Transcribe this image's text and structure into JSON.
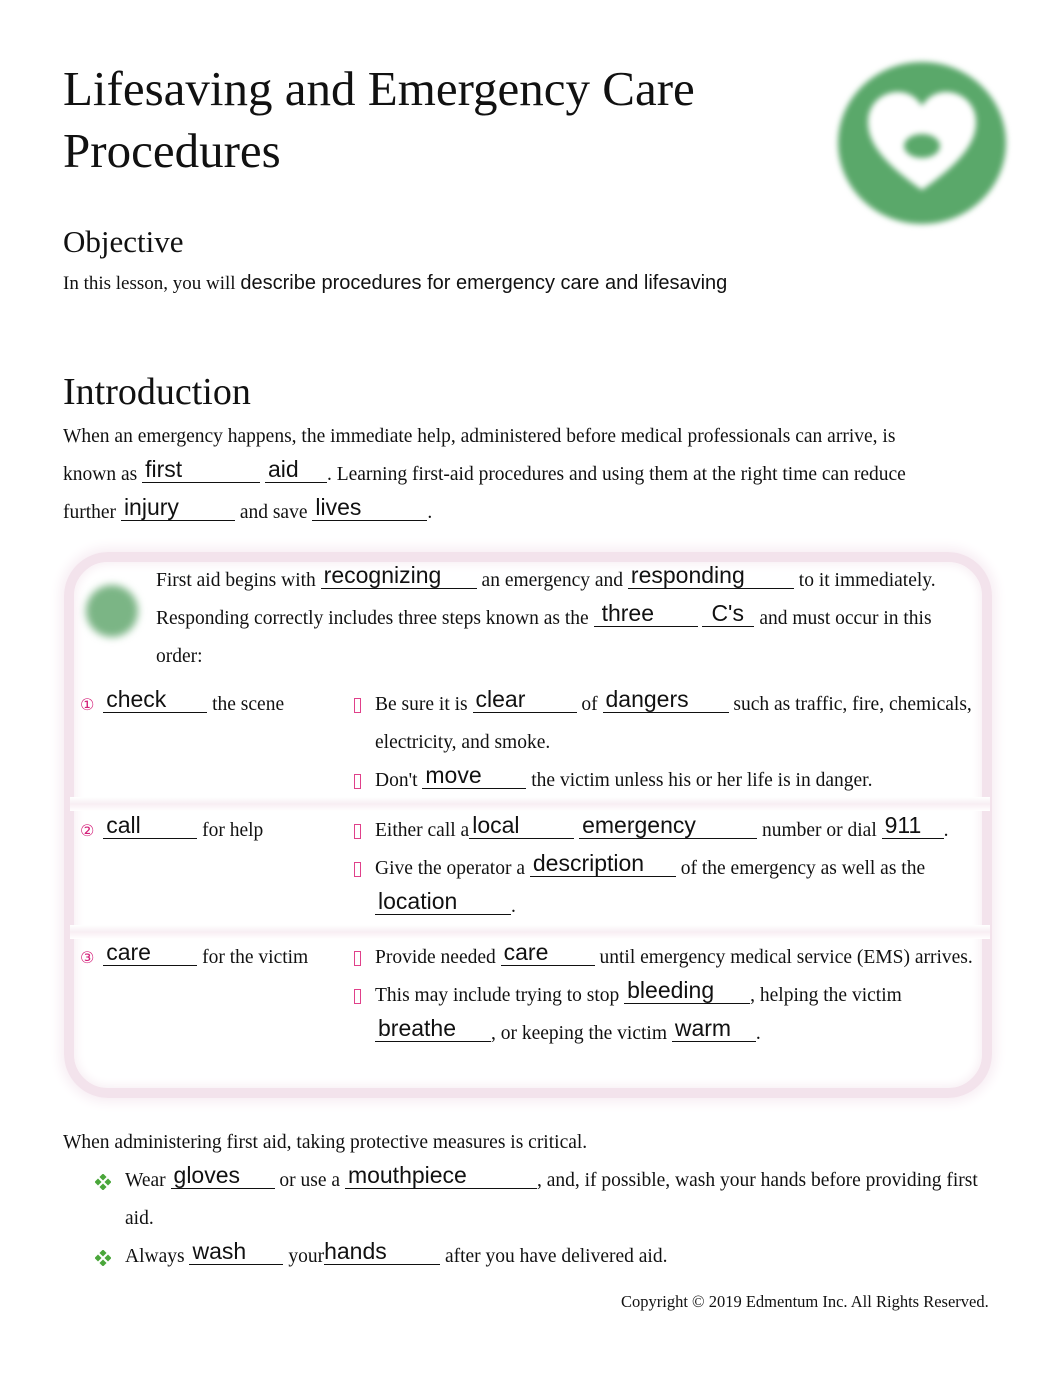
{
  "header": {
    "title": "Lifesaving and Emergency Care Procedures",
    "logo_icon": "heart-icon",
    "logo_color": "#5aa86a"
  },
  "objective": {
    "heading": "Objective",
    "lead": "In this lesson, you will",
    "text": "describe procedures for emergency care and lifesaving"
  },
  "introduction": {
    "heading": "Introduction",
    "p1": "When an emergency happens, the immediate help, administered before medical professionals can arrive, is",
    "p2_a": "known as",
    "blank_first": "first",
    "blank_aid": "aid",
    "p2_b": ". Learning first-aid procedures and using them at the right time can reduce",
    "p3_a": "further",
    "blank_injury": "injury",
    "p3_b": "and save",
    "blank_lives": "lives",
    "p3_c": "."
  },
  "callout": {
    "border_color": "#f3e3ec",
    "icon": "tip-icon",
    "t1": "First aid begins with",
    "blank_recognizing": "recognizing",
    "t2": "an emergency and",
    "blank_responding": "responding",
    "t3": "to it immediately.",
    "t4": "Responding correctly includes three steps known as the",
    "blank_three": "three",
    "blank_cs": "C's",
    "t5": "and must occur in this",
    "t6": "order:",
    "accent_color": "#d4207a",
    "steps": [
      {
        "number": "①",
        "answer": "check",
        "label": "the scene",
        "bullets": [
          {
            "a": "Be sure it is",
            "b1": "clear",
            "m": "of",
            "b2": "dangers",
            "z": "such as traffic, fire, chemicals, electricity, and smoke."
          },
          {
            "a": "Don't",
            "b1": "move",
            "z": "the victim unless his or her life is in danger."
          }
        ]
      },
      {
        "number": "②",
        "answer": "call",
        "label": "for help",
        "bullets": [
          {
            "a": "Either call a",
            "b1": "local",
            "b2": "emergency",
            "m": "number or dial",
            "b3": "911",
            "z": "."
          },
          {
            "a": "Give the operator a",
            "b1": "description",
            "m": "of the emergency as well as the",
            "b2": "location",
            "z": "."
          }
        ]
      },
      {
        "number": "③",
        "answer": "care",
        "label": "for the victim",
        "bullets": [
          {
            "a": "Provide needed",
            "b1": "care",
            "z": "until emergency medical service (EMS) arrives."
          },
          {
            "a": "This may include trying to stop",
            "b1": "bleeding",
            "m": ", helping the victim",
            "b2": "breathe",
            "m2": ", or keeping the victim",
            "b3": "warm",
            "z": "."
          }
        ]
      }
    ]
  },
  "protection": {
    "intro": "When administering first aid, taking protective measures is critical.",
    "bullet_color": "#4aa63a",
    "items": [
      {
        "a": "Wear",
        "b1": "gloves",
        "m": "or use a",
        "b2": "mouthpiece",
        "z": ", and, if possible, wash your hands before providing first aid."
      },
      {
        "a": "Always",
        "b1": "wash",
        "m": "your",
        "b2": "hands",
        "z": "after you have delivered aid."
      }
    ]
  },
  "footer": {
    "copyright": "Copyright © 2019 Edmentum Inc. All Rights Reserved."
  }
}
